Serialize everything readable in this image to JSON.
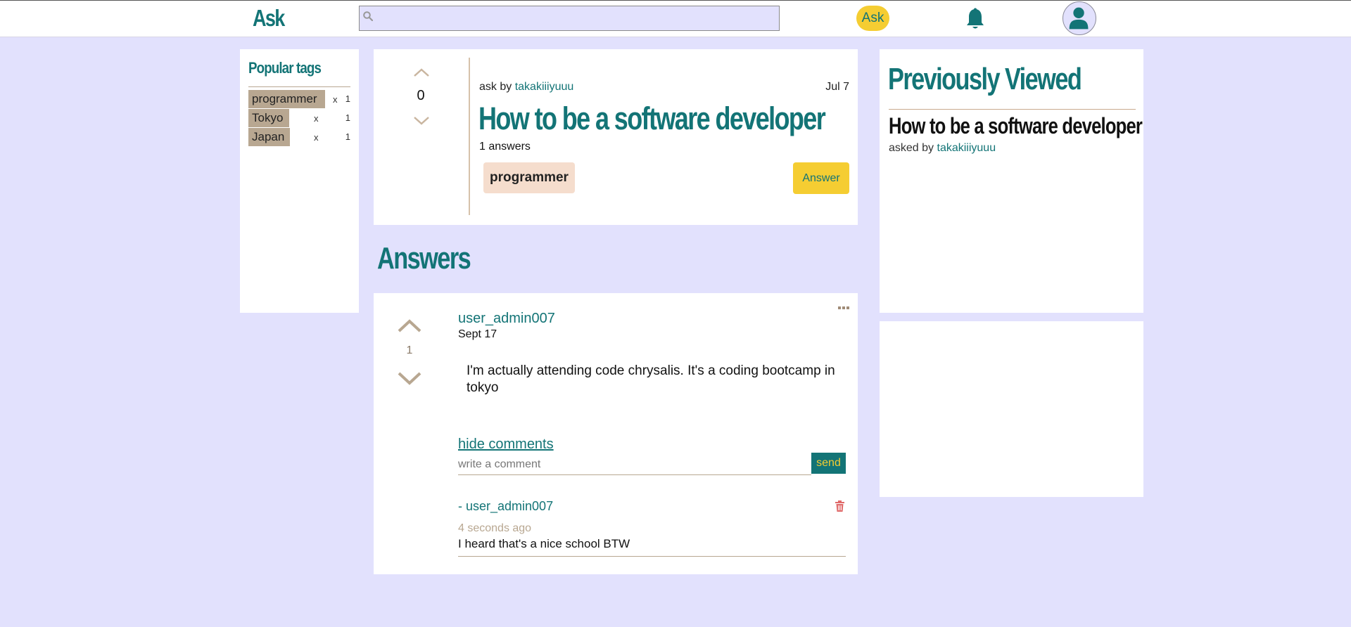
{
  "header": {
    "logo": "Ask",
    "search": {
      "placeholder": "",
      "value": ""
    },
    "ask_button": "Ask"
  },
  "sidebar": {
    "title": "Popular tags",
    "tags": [
      {
        "name": "programmer",
        "x": "x",
        "count": "1"
      },
      {
        "name": "Tokyo",
        "x": "x",
        "count": "1"
      },
      {
        "name": "Japan",
        "x": "x",
        "count": "1"
      }
    ]
  },
  "question": {
    "score": "0",
    "asked_prefix": "ask by",
    "author": "takakiiiyuuu",
    "date": "Jul 7",
    "title": "How to be a software developer",
    "answers_count": "1 answers",
    "tag": "programmer",
    "answer_button": "Answer"
  },
  "answers_heading": "Answers",
  "answer": {
    "score": "1",
    "user": "user_admin007",
    "date": "Sept 17",
    "body": "I'm actually attending code chrysalis. It's a coding bootcamp in tokyo",
    "hide_comments": "hide comments",
    "comment_placeholder": "write a comment",
    "send": "send",
    "comment": {
      "user": "- user_admin007",
      "time": "4 seconds ago",
      "text": "I heard that's a nice school BTW"
    }
  },
  "previously_viewed": {
    "title": "Previously Viewed",
    "item_title": "How to be a software developer",
    "asked_prefix": "asked by",
    "author": "takakiiiyuuu"
  },
  "colors": {
    "accent": "#137476",
    "background": "#e2e1fd",
    "yellow": "#f5cd32",
    "tan": "#b8a791",
    "tag_bg": "#f5ddcd",
    "delete": "#e06a6a"
  },
  "icons": [
    "search-icon",
    "bell-icon",
    "user-icon",
    "chevron-up-icon",
    "chevron-down-icon",
    "more-icon",
    "trash-icon"
  ]
}
